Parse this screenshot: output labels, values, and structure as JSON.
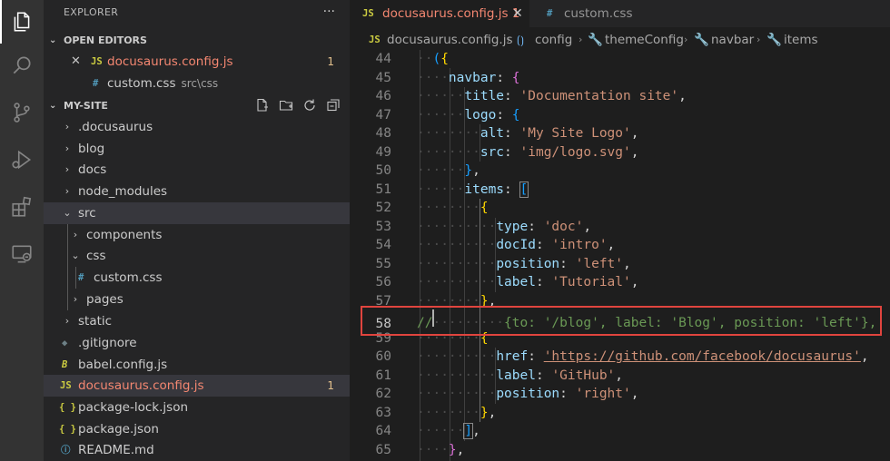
{
  "sidebar": {
    "title": "EXPLORER",
    "more": "···",
    "open_editors": {
      "header": "OPEN EDITORS",
      "items": [
        {
          "name": "docusaurus.config.js",
          "badge": "1",
          "close": "✕"
        },
        {
          "name": "custom.css",
          "hint": "src\\css"
        }
      ]
    },
    "project": {
      "header": "MY-SITE",
      "items": [
        {
          "name": ".docusaurus"
        },
        {
          "name": "blog"
        },
        {
          "name": "docs"
        },
        {
          "name": "node_modules"
        },
        {
          "name": "src"
        },
        {
          "name": "components"
        },
        {
          "name": "css"
        },
        {
          "name": "custom.css"
        },
        {
          "name": "pages"
        },
        {
          "name": "static"
        },
        {
          "name": ".gitignore"
        },
        {
          "name": "babel.config.js"
        },
        {
          "name": "docusaurus.config.js",
          "badge": "1"
        },
        {
          "name": "package-lock.json"
        },
        {
          "name": "package.json"
        },
        {
          "name": "README.md"
        }
      ]
    }
  },
  "icons": {
    "js": "JS",
    "css": "#",
    "json": "{ }",
    "git": "◆",
    "babel": "B",
    "info": "ⓘ",
    "chev_right": "›",
    "chev_down": "⌄"
  },
  "tabs": [
    {
      "name": "docusaurus.config.js",
      "badge": "1",
      "close": "✕"
    },
    {
      "name": "custom.css"
    }
  ],
  "breadcrumb": [
    "docusaurus.config.js",
    "config",
    "themeConfig",
    "navbar",
    "items"
  ],
  "colors": {
    "highlight_box": "#e0443e",
    "modified_file": "#f48771",
    "accent": "#007acc"
  },
  "code": {
    "lines": [
      44,
      45,
      46,
      47,
      48,
      49,
      50,
      51,
      52,
      53,
      54,
      55,
      56,
      57,
      58,
      59,
      60,
      61,
      62,
      63,
      64,
      65
    ],
    "current_line": 58,
    "text": {
      "l44": "({",
      "l45_key": "navbar",
      "l46_key": "title",
      "l46_val": "'Documentation site'",
      "l47_key": "logo",
      "l48_key": "alt",
      "l48_val": "'My Site Logo'",
      "l49_key": "src",
      "l49_val": "'img/logo.svg'",
      "l51_key": "items",
      "l53_key": "type",
      "l53_val": "'doc'",
      "l54_key": "docId",
      "l54_val": "'intro'",
      "l55_key": "position",
      "l55_val": "'left'",
      "l56_key": "label",
      "l56_val": "'Tutorial'",
      "l58_comment": "//",
      "l58_body": "{to: '/blog', label: 'Blog', position: 'left'},",
      "l60_key": "href",
      "l60_val": "'https://github.com/facebook/docusaurus'",
      "l61_key": "label",
      "l61_val": "'GitHub'",
      "l62_key": "position",
      "l62_val": "'right'"
    }
  }
}
